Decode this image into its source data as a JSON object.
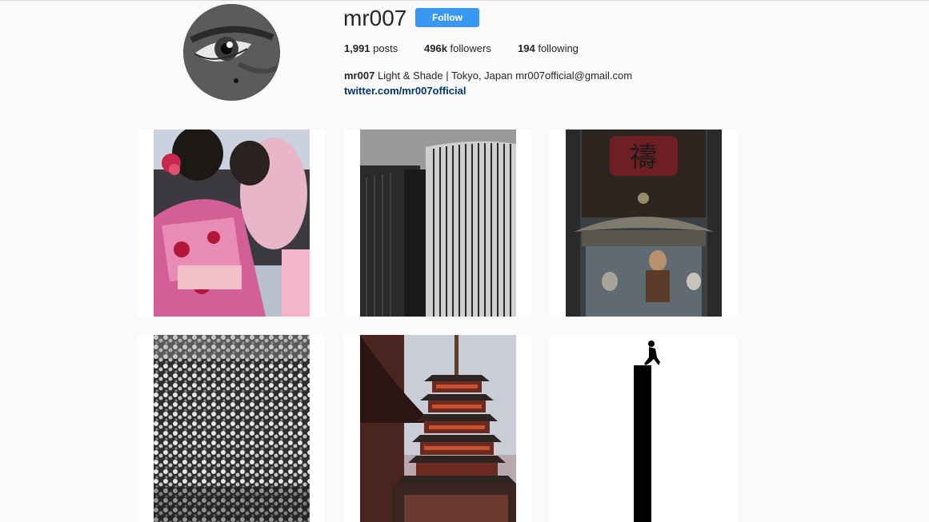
{
  "profile": {
    "username": "mr007",
    "follow_label": "Follow",
    "avatar_icon": "profile-photo-eye",
    "accent_color": "#3897f0",
    "stats": {
      "posts_count": "1,991",
      "posts_label": "posts",
      "followers_count": "496k",
      "followers_label": "followers",
      "following_count": "194",
      "following_label": "following"
    },
    "bio": {
      "name": "mr007",
      "text": "Light & Shade | Tokyo, Japan mr007official@gmail.com",
      "link": "twitter.com/mr007official"
    }
  },
  "grid": {
    "posts": [
      {
        "subject": "women-in-kimono"
      },
      {
        "subject": "black-white-skyscrapers"
      },
      {
        "subject": "temple-incense-burner"
      },
      {
        "subject": "white-flowering-tree"
      },
      {
        "subject": "pagoda-at-dusk"
      },
      {
        "subject": "figure-on-black-pillar"
      }
    ]
  }
}
